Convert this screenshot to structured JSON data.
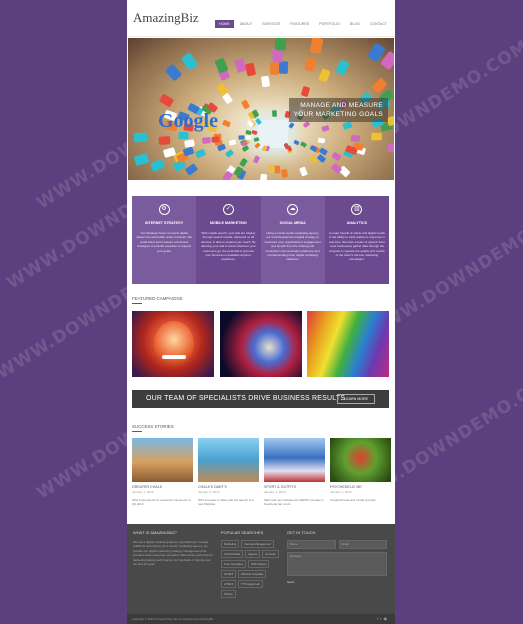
{
  "watermark": "WWW.DOWNDEMO.COM",
  "header": {
    "logo": "AmazingBiz",
    "nav": [
      "Home",
      "About",
      "Services",
      "Features",
      "Portfolio",
      "Blog",
      "Contact"
    ]
  },
  "hero": {
    "logo_text": "Google",
    "headline_1": "Manage and Measure",
    "headline_2": "Your Marketing Goals"
  },
  "services": [
    {
      "title": "Internet Strategy",
      "icon": "gear-icon",
      "color": "#7a5b9e",
      "desc": "Our Strategic Team connects digital values into actionable online behavior. We understand and measure a business strategies to provide expertise to support your goals."
    },
    {
      "title": "Mobile Marketing",
      "icon": "check-icon",
      "color": "#6b4a8f",
      "desc": "With mobile search, your ads are display through search results, delivered on all devices, is able to expand your reach. By allowing your ads to travel wherever your customers go, the potential to promote your business is available anytime, anywhere."
    },
    {
      "title": "Social Media",
      "icon": "cloud-icon",
      "color": "#7a5b9e",
      "desc": "Using a social media marketing agency, our local development digital strategy to maximize your organization's engagement and benefit from the sharing and production communication platforms and complementing other digital marketing initiatives."
    },
    {
      "title": "Analytics",
      "icon": "chart-icon",
      "color": "#6b4a8f",
      "desc": "A major benefit of online and digital media is the ability to track audience response in real time. We have a team of experts from most businesses gather data through the program to operate the quality and results of the client's Internet marketing campaigns."
    }
  ],
  "featured_title": "Featured Campaigns",
  "banner": {
    "text": "Our Team of Specialists Drive Business Results",
    "button": "Learn More"
  },
  "stories_title": "Success Stories",
  "stories": [
    {
      "name": "Greater Chalk",
      "date": "January 1, 2015",
      "desc": "30% improvement in customer conversion in Q3 2013"
    },
    {
      "name": "Chalk's Dart's",
      "date": "January 1, 2015",
      "desc": "50% increase in sales with the launch of a new Website"
    },
    {
      "name": "Sport & Outfits",
      "date": "January 1, 2015",
      "desc": "SEO and new website led 3000% increase in Facebook fan count"
    },
    {
      "name": "Psychedelic Me",
      "date": "January 1, 2015",
      "desc": "Created brand and media program"
    }
  ],
  "footer": {
    "about_title": "What is AmazingBiz?",
    "about_text": "We are a digital marketing agency specializing in Google AdWords advertising. As a search marketing agency, we provide our digital marketing strategy management that provides clear outcomes. Excellent data-driven performance delivering lasting performance for hundreds of brands over the last 10 years.",
    "popular_title": "Popular Searches",
    "tags": [
      "Marketing",
      "Internet Management",
      "Social Media",
      "Agency",
      "E-books",
      "Free Templates",
      "Web Design",
      "HTML5",
      "Website Template",
      "HTML5",
      "TTS Apple Lab",
      "Photos"
    ],
    "touch_title": "Get in Touch",
    "name_placeholder": "Name",
    "email_placeholder": "Email",
    "message_placeholder": "Message",
    "send_label": "Send",
    "copyright": "Copyright © 2015, Privacy Policy Terms. Designed by AmazingBiz"
  }
}
